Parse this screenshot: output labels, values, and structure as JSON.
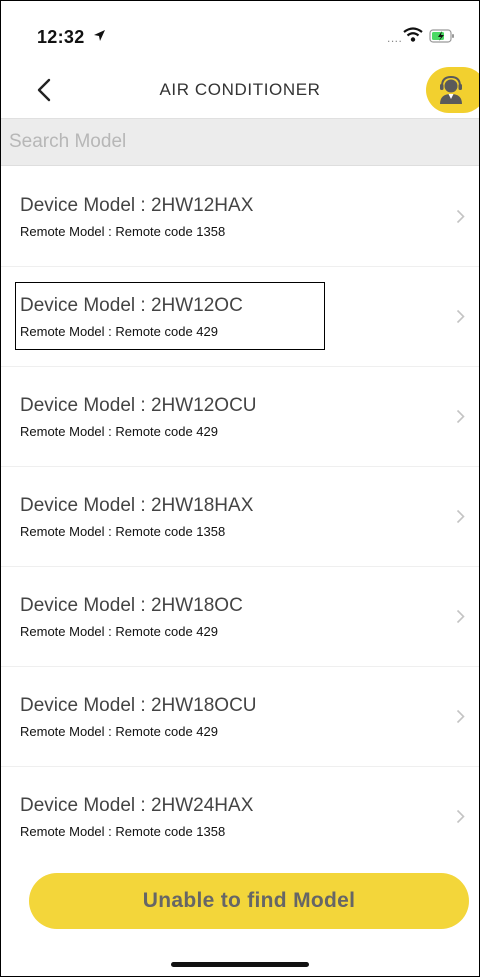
{
  "status_bar": {
    "time": "12:32",
    "signal_text": "....",
    "icons": [
      "location-arrow-icon",
      "wifi-icon",
      "battery-charging-icon"
    ]
  },
  "nav": {
    "title": "AIR CONDITIONER",
    "back_icon": "chevron-left-icon",
    "support_icon": "support-agent-icon",
    "accent": "#f2d02f"
  },
  "search": {
    "placeholder": "Search Model",
    "value": ""
  },
  "models": [
    {
      "device": "Device Model : 2HW12HAX",
      "remote": "Remote Model : Remote code 1358"
    },
    {
      "device": "Device Model : 2HW12OC",
      "remote": "Remote Model : Remote code 429"
    },
    {
      "device": "Device Model : 2HW12OCU",
      "remote": "Remote Model : Remote code 429"
    },
    {
      "device": "Device Model : 2HW18HAX",
      "remote": "Remote Model : Remote code 1358"
    },
    {
      "device": "Device Model : 2HW18OC",
      "remote": "Remote Model : Remote code 429"
    },
    {
      "device": "Device Model : 2HW18OCU",
      "remote": "Remote Model : Remote code 429"
    },
    {
      "device": "Device Model : 2HW24HAX",
      "remote": "Remote Model : Remote code 1358"
    }
  ],
  "bottom": {
    "unable_label": "Unable to find Model",
    "button_color": "#f3d63a"
  }
}
